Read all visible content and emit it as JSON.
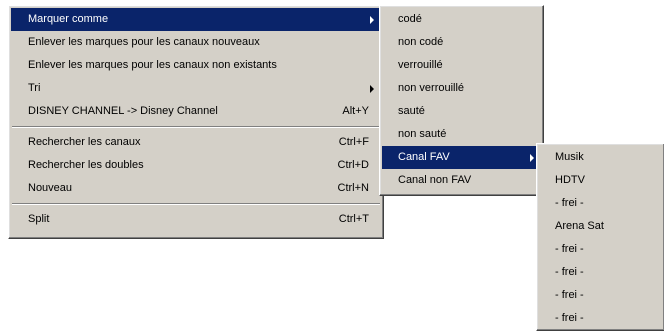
{
  "main_menu": {
    "items": [
      {
        "label": "Marquer comme"
      },
      {
        "label": "Enlever les marques pour les canaux nouveaux"
      },
      {
        "label": "Enlever les marques pour les canaux non existants"
      },
      {
        "label": "Tri"
      },
      {
        "label": "DISNEY CHANNEL -> Disney Channel",
        "shortcut": "Alt+Y"
      },
      {
        "label": "Rechercher les canaux",
        "shortcut": "Ctrl+F"
      },
      {
        "label": "Rechercher les doubles",
        "shortcut": "Ctrl+D"
      },
      {
        "label": "Nouveau",
        "shortcut": "Ctrl+N"
      },
      {
        "label": "Split",
        "shortcut": "Ctrl+T"
      }
    ]
  },
  "mark_submenu": {
    "items": [
      {
        "label": "codé"
      },
      {
        "label": "non codé"
      },
      {
        "label": "verrouillé"
      },
      {
        "label": "non verrouillé"
      },
      {
        "label": "sauté"
      },
      {
        "label": "non sauté"
      },
      {
        "label": "Canal FAV"
      },
      {
        "label": "Canal non FAV"
      }
    ]
  },
  "fav_submenu": {
    "items": [
      {
        "label": "Musik"
      },
      {
        "label": "HDTV"
      },
      {
        "label": "- frei -"
      },
      {
        "label": "Arena Sat"
      },
      {
        "label": "- frei -"
      },
      {
        "label": "- frei -"
      },
      {
        "label": "- frei -"
      },
      {
        "label": "- frei -"
      }
    ]
  },
  "colors": {
    "menu_background": "#d4d0c8",
    "highlight": "#0a246a",
    "highlight_text": "#ffffff"
  }
}
